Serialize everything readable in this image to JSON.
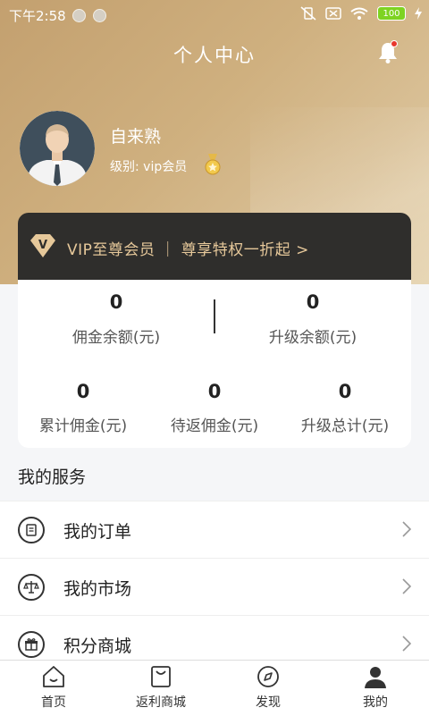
{
  "status_bar": {
    "time": "下午2:58",
    "battery": "100"
  },
  "header": {
    "title": "个人中心"
  },
  "profile": {
    "name": "自来熟",
    "level": "级别: vip会员"
  },
  "vip_banner": {
    "text": "VIP至尊会员 ｜ 尊享特权一折起 >",
    "badge_letter": "V"
  },
  "stats": {
    "row1": [
      {
        "value": "0",
        "label": "佣金余额(元)"
      },
      {
        "value": "0",
        "label": "升级余额(元)"
      }
    ],
    "row2": [
      {
        "value": "0",
        "label": "累计佣金(元)"
      },
      {
        "value": "0",
        "label": "待返佣金(元)"
      },
      {
        "value": "0",
        "label": "升级总计(元)"
      }
    ]
  },
  "services": {
    "title": "我的服务",
    "items": [
      {
        "label": "我的订单",
        "icon": "order-icon"
      },
      {
        "label": "我的市场",
        "icon": "scale-icon"
      },
      {
        "label": "积分商城",
        "icon": "gift-icon"
      }
    ]
  },
  "tabbar": {
    "items": [
      {
        "label": "首页",
        "icon": "home-icon"
      },
      {
        "label": "返利商城",
        "icon": "shopping-bag-icon"
      },
      {
        "label": "发现",
        "icon": "compass-icon"
      },
      {
        "label": "我的",
        "icon": "user-icon"
      }
    ]
  },
  "colors": {
    "gold": "#c8a673",
    "dark_card": "#2f2e2c",
    "vip_text": "#e6c89a"
  }
}
